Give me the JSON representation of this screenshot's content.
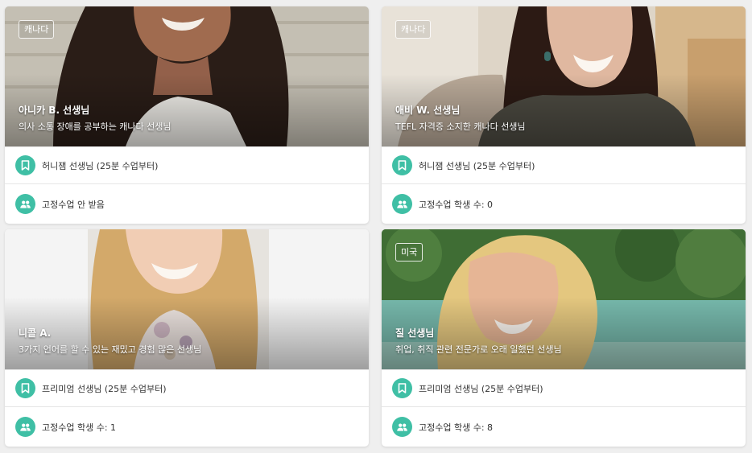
{
  "tutors": [
    {
      "country": "캐나다",
      "name": "아니카 B. 선생님",
      "description": "의사 소통 장애를 공부하는 캐나다 선생님",
      "plan": "허니잼 선생님 (25분 수업부터)",
      "students": "고정수업 안 받음"
    },
    {
      "country": "캐나다",
      "name": "애비 W. 선생님",
      "description": "TEFL 자격증 소지한 캐나다 선생님",
      "plan": "허니잼 선생님 (25분 수업부터)",
      "students": "고정수업 학생 수: 0"
    },
    {
      "country": "",
      "name": "니콜 A.",
      "description": "3가지 언어를 할 수 있는 재밌고 경험 많은 선생님",
      "plan": "프리미엄 선생님 (25분 수업부터)",
      "students": "고정수업 학생 수: 1"
    },
    {
      "country": "미국",
      "name": "질 선생님",
      "description": "취업, 취직 관련 전문가로 오래 일했던 선생님",
      "plan": "프리미엄 선생님 (25분 수업부터)",
      "students": "고정수업 학생 수: 8"
    }
  ],
  "icons": {
    "plan": "bookmark-icon",
    "students": "group-icon"
  },
  "colors": {
    "accent": "#3fbfa5"
  }
}
